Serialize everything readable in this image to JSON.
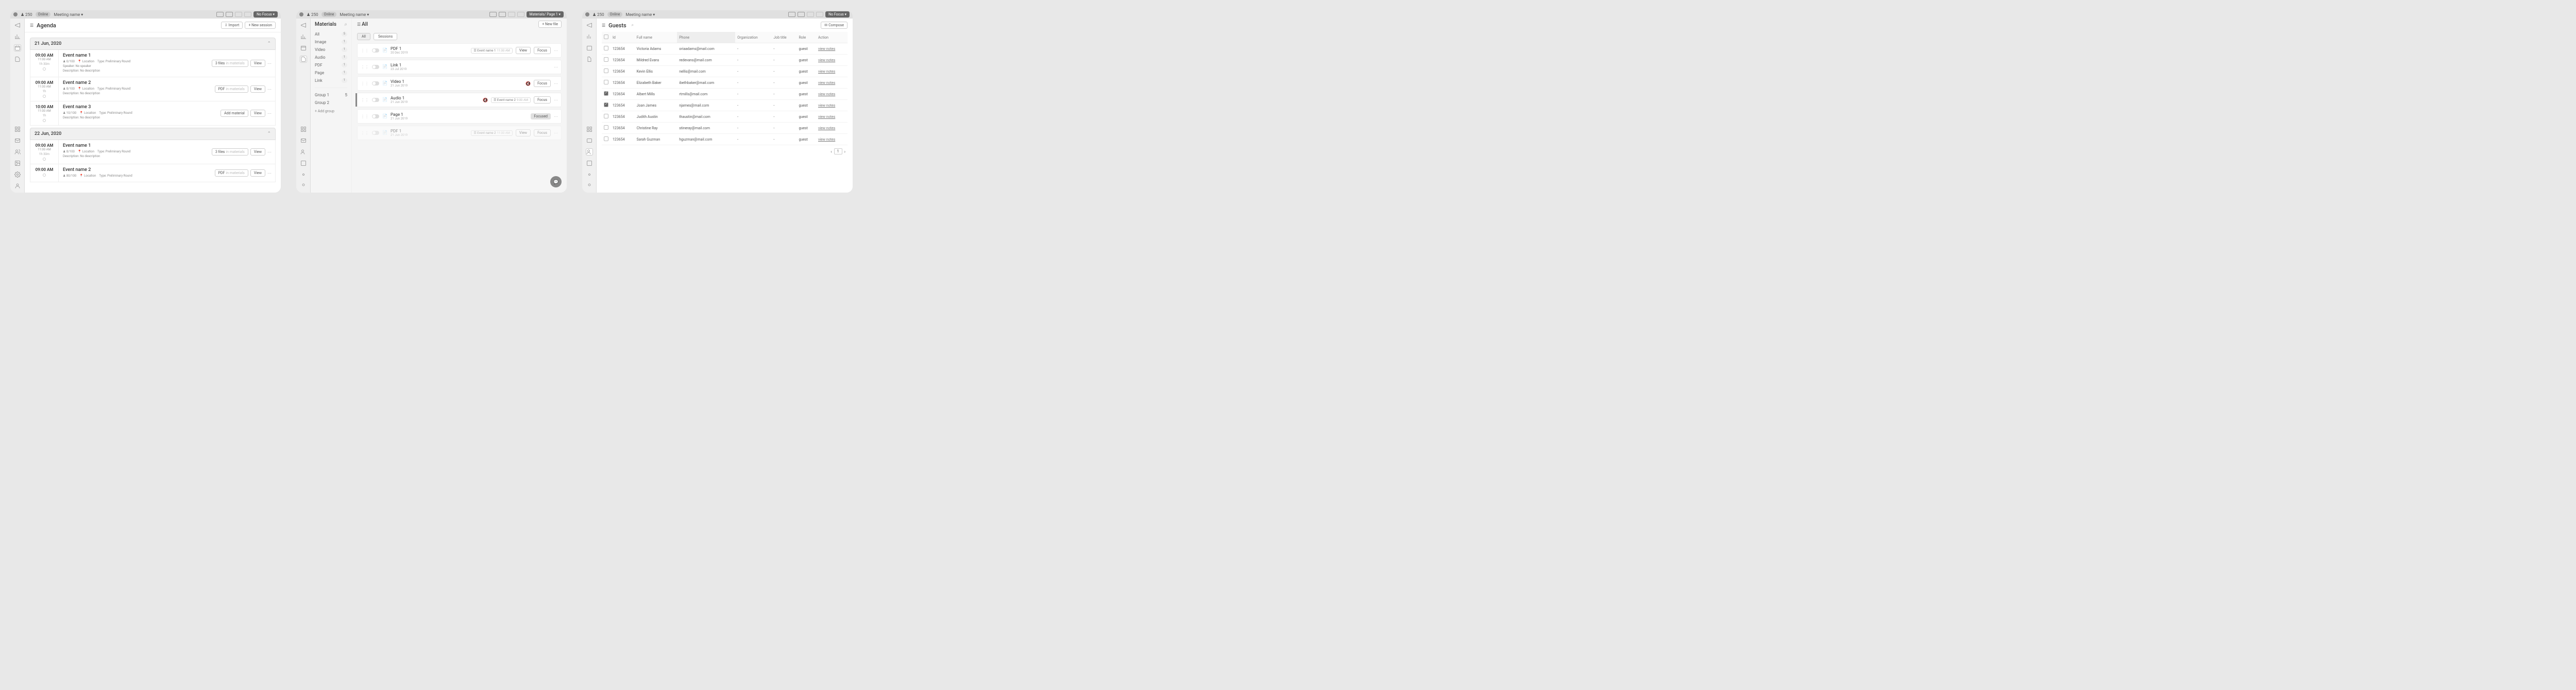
{
  "common": {
    "headcount": "250",
    "onlineLabel": "Online",
    "meetingName": "Meeting name ▾",
    "focusBtn": "No Focus ▾"
  },
  "agenda": {
    "title": "Agenda",
    "importBtn": "Import",
    "newSessionBtn": "+  New session",
    "days": [
      {
        "date": "21 Jun, 2020",
        "sessions": [
          {
            "start": "09:00 AM",
            "end": "11:00 AM",
            "dur": "1h 30m",
            "name": "Event name 1",
            "cap": "0/100",
            "loc": "Location",
            "typeLabel": "Type:",
            "type": "Preliminary Round",
            "spkLabel": "Speaker:",
            "spk": "No speaker",
            "descLabel": "Description:",
            "desc": "No description",
            "act1": "3 files",
            "act1sub": "in materials",
            "act2": "View"
          },
          {
            "start": "09:00 AM",
            "end": "11:00 AM",
            "dur": "1h",
            "name": "Event name 2",
            "cap": "8/100",
            "loc": "Location",
            "typeLabel": "Type:",
            "type": "Preliminary Round",
            "descLabel": "Description:",
            "desc": "No description",
            "act1": "PDF",
            "act1sub": "in materials",
            "act2": "View"
          },
          {
            "start": "10:00 AM",
            "end": "11:00 AM",
            "dur": "1h",
            "name": "Event name 3",
            "cap": "10/100",
            "loc": "Location",
            "typeLabel": "Type:",
            "type": "Preliminary Round",
            "descLabel": "Description:",
            "desc": "No description",
            "act1": "Add material",
            "act2": "View"
          }
        ]
      },
      {
        "date": "22 Jun, 2020",
        "sessions": [
          {
            "start": "09:00 AM",
            "end": "11:00 AM",
            "dur": "1h 30m",
            "name": "Event name 1",
            "cap": "8/100",
            "loc": "Location",
            "typeLabel": "Type:",
            "type": "Preliminary Round",
            "descLabel": "Description:",
            "desc": "No description",
            "act1": "3 files",
            "act1sub": "in materials",
            "act2": "View"
          },
          {
            "start": "09:00 AM",
            "end": "",
            "dur": "",
            "name": "Event name 2",
            "cap": "80/100",
            "loc": "Location",
            "typeLabel": "Type:",
            "type": "Preliminary Round",
            "act1": "PDF",
            "act1sub": "in materials",
            "act2": "View"
          }
        ]
      }
    ]
  },
  "materials": {
    "focusBtn": "Materials/ Page 1 ▾",
    "sideTitle": "Materials",
    "cats": [
      {
        "name": "All",
        "cnt": "5"
      },
      {
        "name": "Image",
        "cnt": "1"
      },
      {
        "name": "Video",
        "cnt": "1"
      },
      {
        "name": "Audio",
        "cnt": "1"
      },
      {
        "name": "PDF",
        "cnt": "1"
      },
      {
        "name": "Page",
        "cnt": "1"
      },
      {
        "name": "Link",
        "cnt": "1"
      }
    ],
    "groups": [
      {
        "name": "Group 1",
        "cnt": "5"
      },
      {
        "name": "Group 2"
      }
    ],
    "addGroup": "+ Add group",
    "allTitle": "All",
    "newFileBtn": "+  New file",
    "tabAll": "All",
    "tabSessions": "Sessions",
    "rows": [
      {
        "name": "PDF 1",
        "date": "20 Dec 2019",
        "chip": "Event name 1",
        "chipTime": "11:00 AM",
        "view": "View",
        "focus": "Focus"
      },
      {
        "name": "Link 1",
        "date": "23 Jul 2019"
      },
      {
        "name": "Video 1",
        "date": "21 Jun 2019",
        "mute": true,
        "focus": "Focus"
      },
      {
        "name": "Audio 1",
        "date": "21 Jun 2019",
        "mute": true,
        "chip": "Event name 2",
        "chipTime": "9:00 AM",
        "focus": "Focus",
        "focused": true
      },
      {
        "name": "Page 1",
        "date": "21 Jun 2019",
        "focusedChip": "Focused"
      },
      {
        "name": "PDF 1",
        "date": "21 Jun 2019",
        "dim": true,
        "chip": "Event name 2",
        "chipTime": "11:00 AM",
        "view": "View",
        "focus": "Focus"
      }
    ]
  },
  "guests": {
    "title": "Guests",
    "composeBtn": "Compose",
    "cols": {
      "id": "Id",
      "name": "Full name",
      "phone": "Phone",
      "org": "Organization",
      "job": "Job title",
      "role": "Role",
      "action": "Action"
    },
    "rows": [
      {
        "id": "123654",
        "name": "Victoria Adams",
        "email": "oriaadams@mail.com",
        "role": "guest",
        "action": "view notes"
      },
      {
        "id": "123654",
        "name": "Mildred Evans",
        "email": "redevans@mail.com",
        "role": "guest",
        "action": "view notes"
      },
      {
        "id": "123654",
        "name": "Kevin Ellis",
        "email": "nellis@mail.com",
        "role": "guest",
        "action": "view notes"
      },
      {
        "id": "123654",
        "name": "Elizabeth Baker",
        "email": "ibethbaker@mail.com",
        "role": "guest",
        "action": "view notes"
      },
      {
        "id": "123654",
        "name": "Albert Mills",
        "email": "rtmills@mail.com",
        "role": "guest",
        "action": "view notes",
        "checked": true
      },
      {
        "id": "123654",
        "name": "Joan James",
        "email": "njames@mail.com",
        "role": "guest",
        "action": "view notes",
        "checked": true
      },
      {
        "id": "123654",
        "name": "Judith Austin",
        "email": "thaustin@mail.com",
        "role": "guest",
        "action": "view notes"
      },
      {
        "id": "123654",
        "name": "Christine Ray",
        "email": "stineray@mail.com",
        "role": "guest",
        "action": "view notes"
      },
      {
        "id": "123654",
        "name": "Sarah Guzman",
        "email": "hguzman@mail.com",
        "role": "guest",
        "action": "view notes"
      }
    ],
    "dash": "-",
    "page": "1"
  }
}
